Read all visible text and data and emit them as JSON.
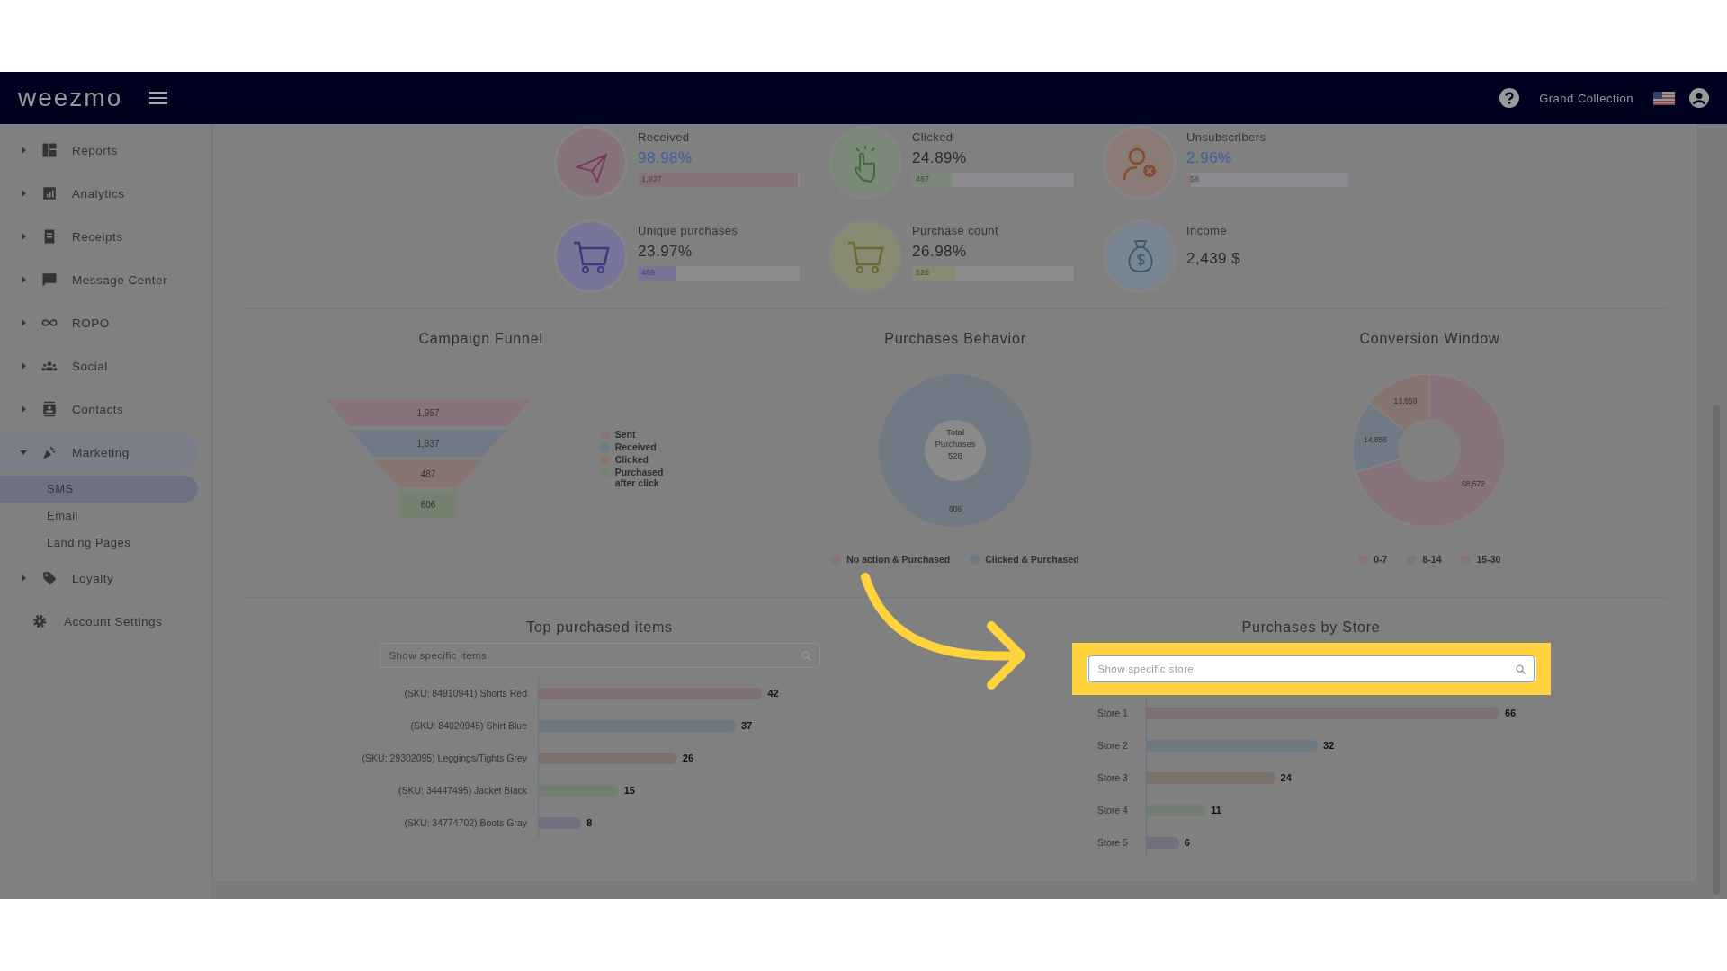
{
  "header": {
    "logo": "weezmo",
    "account": "Grand Collection"
  },
  "sidebar": {
    "items": [
      {
        "kind": "group",
        "label": "Reports",
        "expanded": false
      },
      {
        "kind": "group",
        "label": "Analytics",
        "expanded": false
      },
      {
        "kind": "group",
        "label": "Receipts",
        "expanded": false
      },
      {
        "kind": "group",
        "label": "Message Center",
        "expanded": false
      },
      {
        "kind": "group",
        "label": "ROPO",
        "expanded": false
      },
      {
        "kind": "group",
        "label": "Social",
        "expanded": false
      },
      {
        "kind": "group",
        "label": "Contacts",
        "expanded": false
      },
      {
        "kind": "group",
        "label": "Marketing",
        "expanded": true,
        "children": [
          {
            "label": "SMS",
            "selected": true
          },
          {
            "label": "Email",
            "selected": false
          },
          {
            "label": "Landing Pages",
            "selected": false
          }
        ]
      },
      {
        "kind": "group",
        "label": "Loyalty",
        "expanded": false
      },
      {
        "kind": "link",
        "label": "Account Settings"
      }
    ]
  },
  "metrics": [
    {
      "label": "Received",
      "value": "98.98%",
      "link": true,
      "count": "1,937",
      "level": 0.99,
      "color": "#86737c"
    },
    {
      "label": "Clicked",
      "value": "24.89%",
      "link": false,
      "count": "487",
      "level": 0.25,
      "color": "#7b8a78"
    },
    {
      "label": "Unsubscribers",
      "value": "2.96%",
      "link": true,
      "count": "58",
      "level": 0.03,
      "color": "#8a7b76"
    },
    {
      "label": "Unique purchases",
      "value": "23.97%",
      "link": false,
      "count": "469",
      "level": 0.24,
      "color": "#77749a"
    },
    {
      "label": "Purchase count",
      "value": "26.98%",
      "link": false,
      "count": "528",
      "level": 0.27,
      "color": "#898a72"
    },
    {
      "label": "Income",
      "value": "2,439 $",
      "link": false,
      "color": "#798590"
    }
  ],
  "funnel": {
    "title": "Campaign Funnel",
    "stages": [
      "1,957",
      "1,937",
      "487",
      "606"
    ],
    "legend": [
      {
        "label": "Sent",
        "color": "#86737c"
      },
      {
        "label": "Received",
        "color": "#6f7a84"
      },
      {
        "label": "Clicked",
        "color": "#84766f"
      },
      {
        "label": "Purchased after click",
        "color": "#74826f"
      }
    ]
  },
  "behavior": {
    "title": "Purchases Behavior",
    "center_text": "Total Purchases 528",
    "chart_data": {
      "type": "donut",
      "categories": [
        "No action & Purchased",
        "Clicked & Purchased"
      ],
      "values": [
        0,
        606
      ],
      "data_labels": true
    },
    "legend": [
      {
        "color": "#86737c"
      },
      {
        "color": "#6f7a84"
      }
    ]
  },
  "conversion": {
    "title": "Conversion Window",
    "chart_data": {
      "type": "donut",
      "categories": [
        "0-7",
        "8-14",
        "15-30"
      ],
      "values": [
        68572,
        14856,
        13859
      ],
      "value_labels": [
        "68,572",
        "14,856",
        "13,859"
      ]
    },
    "legend": [
      {
        "color": "#86737c"
      },
      {
        "color": "#6f7a84"
      },
      {
        "color": "#84766f"
      }
    ]
  },
  "top_items": {
    "title": "Top purchased items",
    "search": {
      "placeholder": "Show specific items",
      "highlighted": false
    },
    "chart_data": {
      "type": "bar",
      "orientation": "horizontal",
      "categories": [
        "(SKU: 84910941) Shorts Red",
        "(SKU: 84020945) Shirt Blue",
        "(SKU: 29302095) Leggings/Tights Grey",
        "(SKU: 34447495) Jacket Black",
        "(SKU: 34774702) Boots Gray"
      ],
      "values": [
        42,
        37,
        26,
        15,
        8
      ],
      "data_labels": true
    }
  },
  "stores": {
    "title": "Purchases by Store",
    "search": {
      "placeholder": "Show specific store",
      "highlighted": true
    },
    "chart_data": {
      "type": "bar",
      "orientation": "horizontal",
      "categories": [
        "Store 1",
        "Store 2",
        "Store 3",
        "Store 4",
        "Store 5"
      ],
      "values": [
        66,
        32,
        24,
        11,
        6
      ],
      "data_labels": true
    }
  }
}
